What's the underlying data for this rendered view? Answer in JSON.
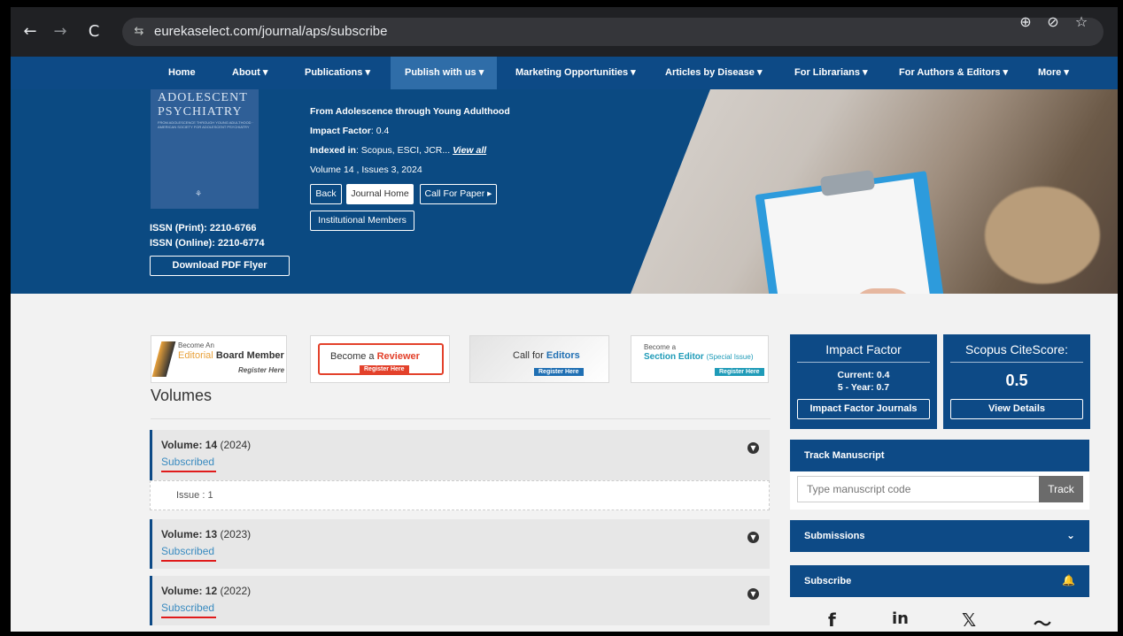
{
  "browser": {
    "url": "eurekaselect.com/journal/aps/subscribe",
    "back_icon": "←",
    "forward_icon": "→",
    "reload_icon": "C",
    "site_icon": "⇆",
    "zoom_icon": "⊕",
    "eye_icon": "⊘",
    "star_icon": "☆"
  },
  "nav": {
    "items": [
      {
        "label": "Home"
      },
      {
        "label": "About ▾"
      },
      {
        "label": "Publications ▾"
      },
      {
        "label": "Publish with us ▾"
      },
      {
        "label": "Marketing Opportunities ▾"
      },
      {
        "label": "Articles by Disease ▾"
      },
      {
        "label": "For Librarians ▾"
      },
      {
        "label": "For Authors & Editors ▾"
      },
      {
        "label": "More ▾"
      }
    ]
  },
  "journal": {
    "cover_title_1": "ADOLESCENT",
    "cover_title_2": "PSYCHIATRY",
    "cover_subtitle": "FROM ADOLESCENCE THROUGH YOUNG ADULTHOOD · AMERICAN SOCIETY FOR ADOLESCENT PSYCHIATRY",
    "subtitle": "From Adolescence through Young Adulthood",
    "impact_label": "Impact Factor",
    "impact_value": ": 0.4",
    "indexed_label": "Indexed in",
    "indexed_value": ": Scopus, ESCI, JCR... ",
    "view_all": "View all",
    "volume_info": "Volume 14 , Issues 3, 2024",
    "issn_print": "ISSN (Print): 2210-6766",
    "issn_online": "ISSN (Online): 2210-6774",
    "download_flyer": "Download PDF Flyer",
    "btn_back": "Back",
    "btn_journal_home": "Journal Home",
    "btn_call_for_paper": "Call For Paper ▸",
    "btn_institutional": "Institutional Members"
  },
  "banners": {
    "editorial_small": "Become An",
    "editorial_big_1": "Editorial",
    "editorial_big_2": "Board Member",
    "editorial_reg": "Register Here",
    "reviewer_text": "Become a",
    "reviewer_bold": "Reviewer",
    "reviewer_reg": "Register Here",
    "editors_text": "Call for",
    "editors_bold": "Editors",
    "editors_reg": "Register Here",
    "section_small": "Become a",
    "section_big": "Section Editor",
    "section_paren": "(Special Issue)",
    "section_reg": "Register Here"
  },
  "volumes": {
    "title": "Volumes",
    "list": [
      {
        "label": "Volume: 14",
        "year": "(2024)",
        "status": "Subscribed"
      },
      {
        "label": "Volume: 13",
        "year": "(2023)",
        "status": "Subscribed"
      },
      {
        "label": "Volume: 12",
        "year": "(2022)",
        "status": "Subscribed"
      }
    ],
    "issue_label": "Issue : 1"
  },
  "sidebar": {
    "impact_title": "Impact Factor",
    "impact_current": "Current: 0.4",
    "impact_5yr": "5 - Year: 0.7",
    "impact_btn": "Impact Factor Journals",
    "scopus_title": "Scopus CiteScore:",
    "scopus_value": "0.5",
    "scopus_btn": "View Details",
    "track_title": "Track Manuscript",
    "track_placeholder": "Type manuscript code",
    "track_btn": "Track",
    "submissions": "Submissions",
    "subscribe": "Subscribe",
    "social": [
      "f",
      "in",
      "𝕏",
      "〜"
    ]
  }
}
